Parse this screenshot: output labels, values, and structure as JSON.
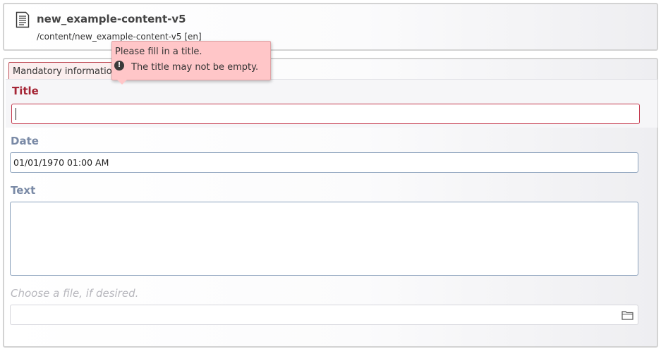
{
  "header": {
    "icon": "document-icon",
    "title": "new_example-content-v5",
    "path": "/content/new_example-content-v5 [en]"
  },
  "tabs": [
    {
      "label": "Mandatory information",
      "active": true
    }
  ],
  "form": {
    "title": {
      "label": "Title",
      "value": "",
      "state": "error"
    },
    "date": {
      "label": "Date",
      "value": "01/01/1970 01:00 AM"
    },
    "text": {
      "label": "Text",
      "value": ""
    },
    "file": {
      "label": "Choose a file, if desired.",
      "value": "",
      "icon": "folder-icon"
    }
  },
  "validation_tooltip": {
    "heading": "Please fill in a title.",
    "icon": "exclamation-icon",
    "icon_glyph": "!",
    "message": "The title may not be empty."
  },
  "colors": {
    "error": "#a52636",
    "label": "#7a8aa6",
    "tooltip_bg": "#ffc6c8",
    "field_border": "#8aa0bb"
  }
}
